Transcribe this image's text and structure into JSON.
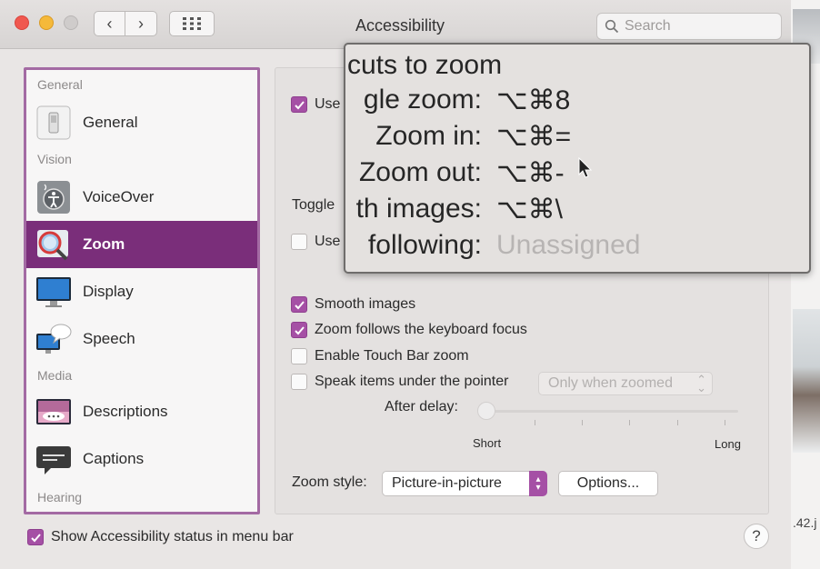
{
  "window": {
    "title": "Accessibility"
  },
  "search": {
    "placeholder": "Search"
  },
  "sidebar": {
    "sections": {
      "general": "General",
      "vision": "Vision",
      "media": "Media",
      "hearing": "Hearing"
    },
    "items": [
      {
        "label": "General"
      },
      {
        "label": "VoiceOver"
      },
      {
        "label": "Zoom"
      },
      {
        "label": "Display"
      },
      {
        "label": "Speech"
      },
      {
        "label": "Descriptions"
      },
      {
        "label": "Captions"
      }
    ]
  },
  "panel": {
    "use_keyboard": "Use",
    "toggle_label": "Toggle",
    "use_scroll": "Use",
    "smooth_images": "Smooth images",
    "follows_focus": "Zoom follows the keyboard focus",
    "touch_bar": "Enable Touch Bar zoom",
    "speak_items": "Speak items under the pointer",
    "speak_popup_value": "Only when zoomed",
    "after_delay": "After delay:",
    "slider_short": "Short",
    "slider_long": "Long",
    "zoom_style_label": "Zoom style:",
    "zoom_style_value": "Picture-in-picture",
    "options_button": "Options..."
  },
  "zoom_overlay": {
    "title": "cuts to zoom",
    "rows": [
      {
        "label": "gle zoom:",
        "value": "⌥⌘8"
      },
      {
        "label": "Zoom in:",
        "value": "⌥⌘="
      },
      {
        "label": "Zoom out:",
        "value": "⌥⌘-"
      },
      {
        "label": "th images:",
        "value": "⌥⌘\\"
      },
      {
        "label": "following:",
        "value": "Unassigned"
      }
    ]
  },
  "footer": {
    "status_label": "Show Accessibility status in menu bar",
    "help": "?"
  },
  "background": {
    "file_fragment": ".42.j"
  },
  "state": {
    "selected_sidebar": "Zoom",
    "checked": [
      "use_keyboard",
      "smooth_images",
      "follows_focus",
      "status_in_menu_bar"
    ],
    "slider_delay_fraction": 0.0
  },
  "colors": {
    "accent": "#a550a5",
    "selected_row": "#7a2e7a",
    "sidebar_border": "#a36aa3"
  }
}
